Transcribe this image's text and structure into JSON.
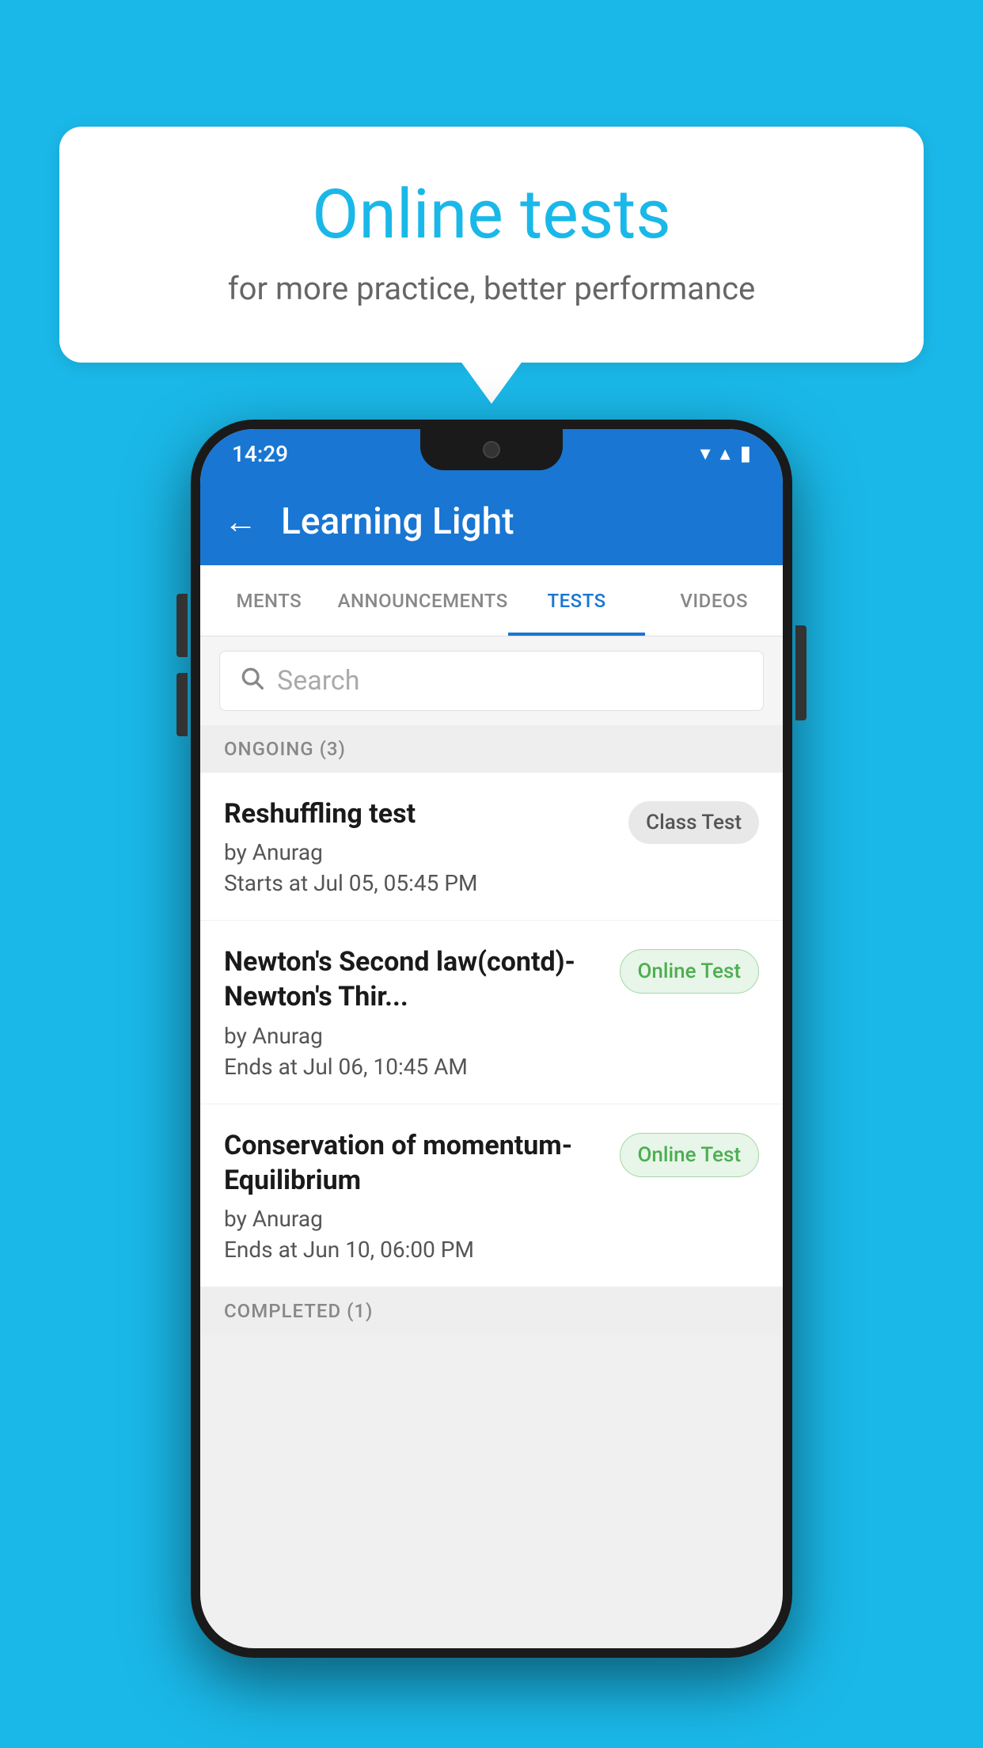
{
  "background_color": "#1ab8e8",
  "speech_bubble": {
    "title": "Online tests",
    "subtitle": "for more practice, better performance"
  },
  "phone": {
    "status_bar": {
      "time": "14:29",
      "wifi": "▼",
      "signal": "▲",
      "battery": "▮"
    },
    "header": {
      "back_label": "←",
      "title": "Learning Light"
    },
    "tabs": [
      {
        "label": "MENTS",
        "active": false
      },
      {
        "label": "ANNOUNCEMENTS",
        "active": false
      },
      {
        "label": "TESTS",
        "active": true
      },
      {
        "label": "VIDEOS",
        "active": false
      }
    ],
    "search": {
      "placeholder": "Search"
    },
    "ongoing_section": {
      "label": "ONGOING (3)"
    },
    "tests": [
      {
        "name": "Reshuffling test",
        "author": "by Anurag",
        "date": "Starts at  Jul 05, 05:45 PM",
        "badge": "Class Test",
        "badge_type": "class"
      },
      {
        "name": "Newton's Second law(contd)-Newton's Thir...",
        "author": "by Anurag",
        "date": "Ends at  Jul 06, 10:45 AM",
        "badge": "Online Test",
        "badge_type": "online"
      },
      {
        "name": "Conservation of momentum-Equilibrium",
        "author": "by Anurag",
        "date": "Ends at  Jun 10, 06:00 PM",
        "badge": "Online Test",
        "badge_type": "online"
      }
    ],
    "completed_section": {
      "label": "COMPLETED (1)"
    }
  }
}
